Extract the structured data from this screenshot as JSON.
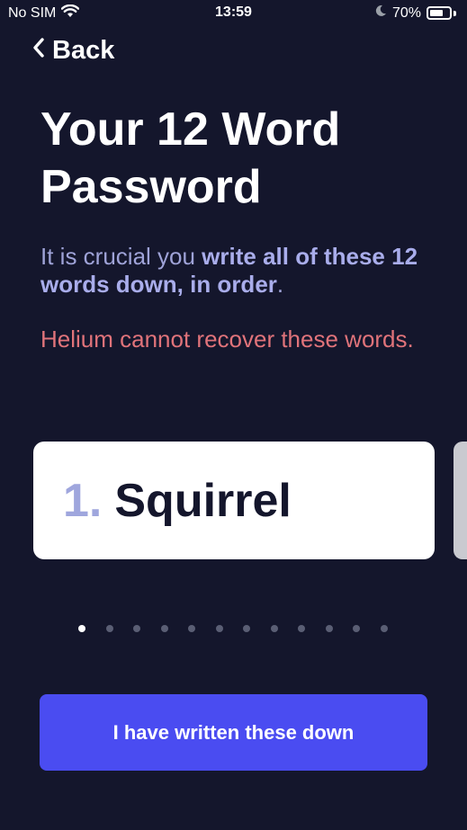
{
  "status_bar": {
    "carrier": "No SIM",
    "time": "13:59",
    "battery_percent": "70%",
    "battery_level": 0.7,
    "icons": [
      "wifi-icon",
      "moon-icon",
      "battery-icon"
    ]
  },
  "nav": {
    "back_label": "Back"
  },
  "title": {
    "line1": "Your 12 Word",
    "line2": "Password"
  },
  "instruction": {
    "prefix": "It is crucial you ",
    "emphasis": "write all of these 12 words down, in order",
    "suffix": "."
  },
  "warning": "Helium cannot recover these words.",
  "current_word": {
    "index": "1.",
    "word": "Squirrel"
  },
  "pager": {
    "total": 12,
    "current": 1
  },
  "confirm_button": "I have written these down",
  "colors": {
    "background": "#14162c",
    "accent": "#4a4cf1",
    "warning": "#e0737a",
    "muted": "#9fa3d8"
  }
}
